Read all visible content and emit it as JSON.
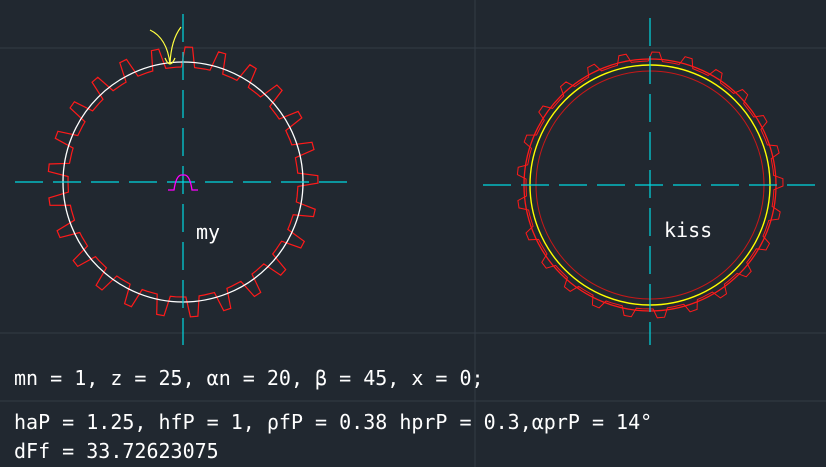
{
  "colors": {
    "background": "#212830",
    "grid": "#323b45",
    "centerline": "#00d8e0",
    "gear_teeth": "#ff1a1a",
    "pitch_circle": "#ffffff",
    "rack_profile": "#ff00ff",
    "flank_curve": "#ffff40",
    "kiss_circle": "#ffff00",
    "text": "#ffffff"
  },
  "labels": {
    "my": "my",
    "kiss": "kiss"
  },
  "notes": {
    "line1": "mn = 1, z = 25, αn = 20, β = 45, x = 0;",
    "line2": "haP = 1.25, hfP = 1, ρfP = 0.38 hprP = 0.3,αprP = 14°",
    "line3": "dFf = 33.72623075"
  },
  "gear": {
    "tooth_count": 25
  }
}
